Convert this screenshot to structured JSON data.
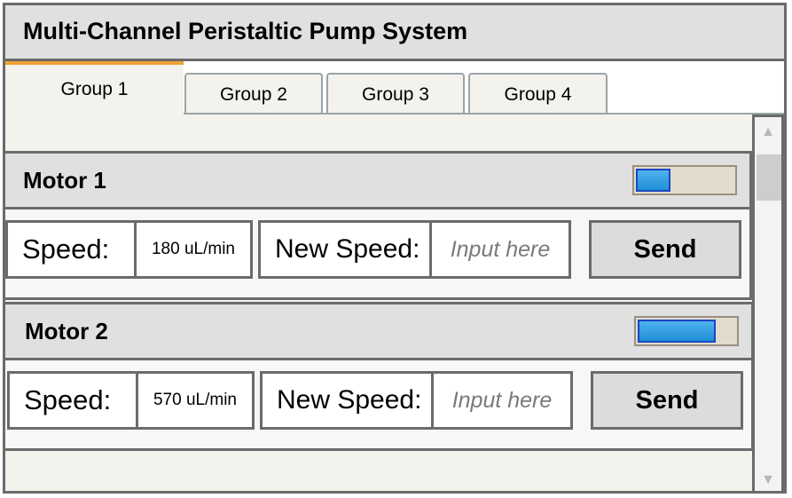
{
  "app": {
    "title": "Multi-Channel Peristaltic Pump System"
  },
  "tabs": [
    {
      "label": "Group 1",
      "active": true
    },
    {
      "label": "Group 2",
      "active": false
    },
    {
      "label": "Group 3",
      "active": false
    },
    {
      "label": "Group 4",
      "active": false
    }
  ],
  "motors": [
    {
      "name": "Motor 1",
      "toggle_level": 0.35,
      "speed_label": "Speed:",
      "speed_value": "180 uL/min",
      "new_speed_label": "New Speed:",
      "new_speed_placeholder": "Input here",
      "new_speed_value": "",
      "send_label": "Send"
    },
    {
      "name": "Motor 2",
      "toggle_level": 0.8,
      "speed_label": "Speed:",
      "speed_value": "570 uL/min",
      "new_speed_label": "New Speed:",
      "new_speed_placeholder": "Input here",
      "new_speed_value": "",
      "send_label": "Send"
    }
  ],
  "scrollbar": {
    "up_icon": "triangle-up-icon",
    "down_icon": "triangle-down-icon"
  },
  "colors": {
    "accent_tab": "#f0a030",
    "toggle_fill": "#1f8fd6",
    "toggle_border": "#1a46c4"
  }
}
